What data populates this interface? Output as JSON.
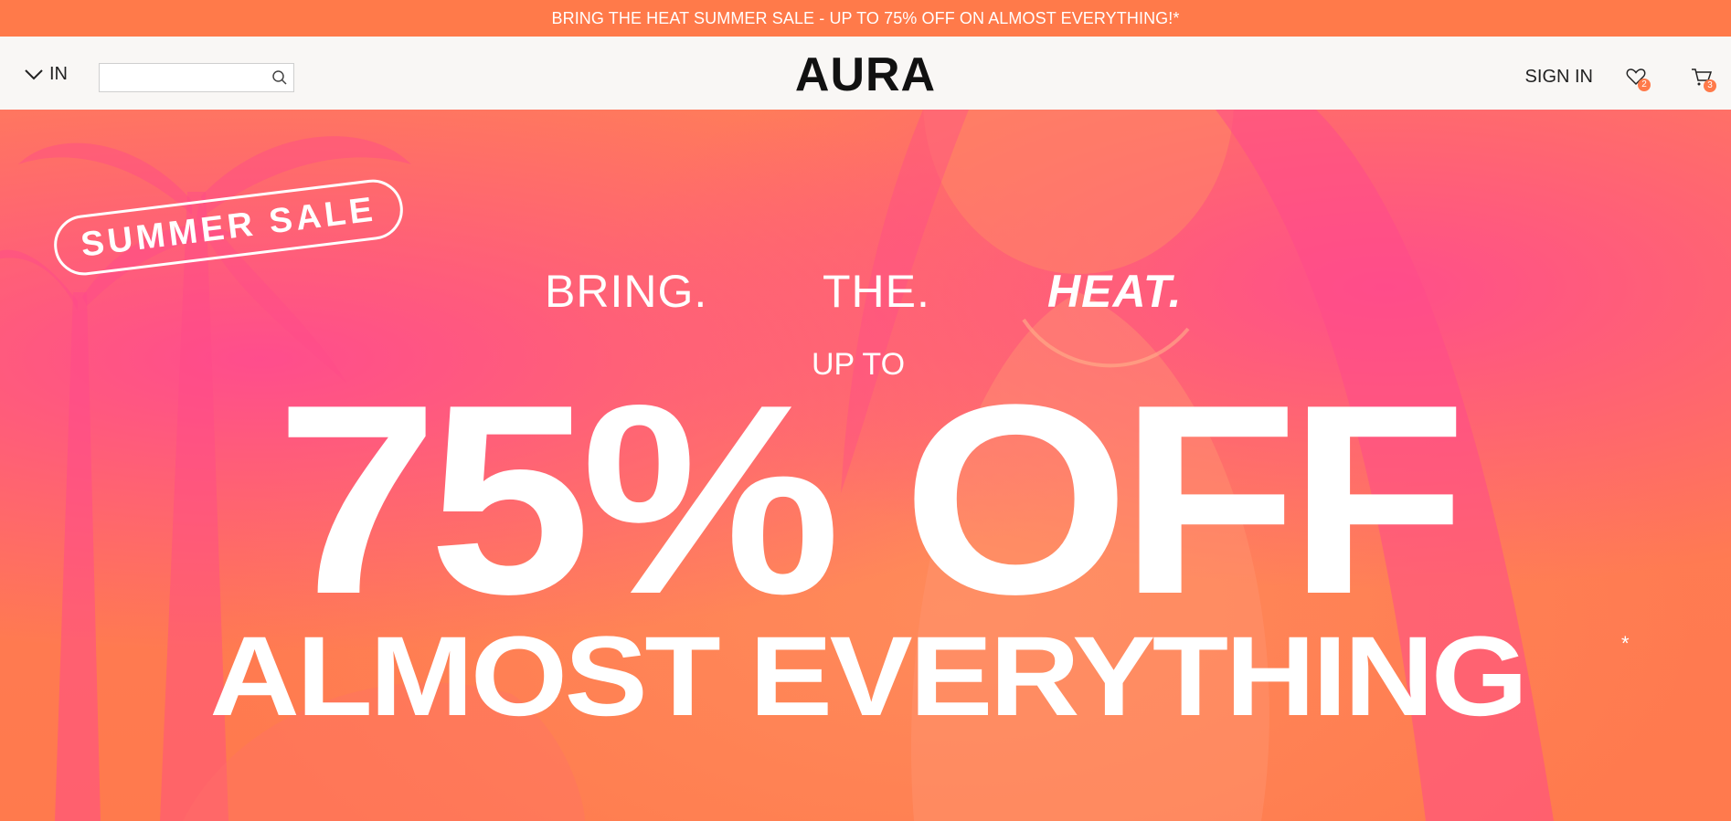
{
  "promo": {
    "text": "BRING THE HEAT SUMMER SALE - UP TO 75% OFF ON ALMOST EVERYTHING!*"
  },
  "header": {
    "country_label": "IN",
    "search_placeholder": "",
    "logo": "AURA",
    "signin_label": "SIGN IN",
    "wishlist_count": "2",
    "cart_count": "3"
  },
  "hero": {
    "badge": "SUMMER SALE",
    "tagline": [
      "BRING.",
      "THE.",
      "HEAT."
    ],
    "up_to": "UP TO",
    "discount": "75% OFF",
    "subline": "ALMOST EVERYTHING",
    "asterisk": "*"
  },
  "colors": {
    "accent": "#ff7a4a",
    "pink": "#ff4d8d",
    "header_bg": "#f9f7f5"
  },
  "icons": {
    "country": "chevron-down-icon",
    "search": "search-icon",
    "wishlist": "heart-icon",
    "cart": "cart-icon"
  }
}
